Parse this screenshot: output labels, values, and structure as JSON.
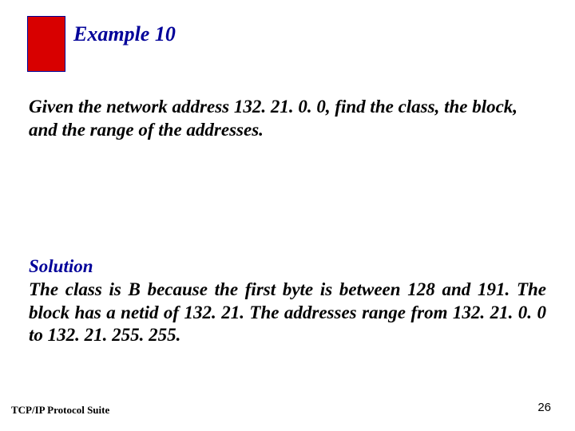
{
  "title": {
    "label": "Example",
    "number": "10"
  },
  "question": "Given the network address 132. 21. 0. 0, find the class, the block, and the range of the addresses.",
  "solution": {
    "label": "Solution",
    "body": "The class is B because the first byte is between 128 and 191. The block has a netid of 132. 21. The addresses range from 132. 21. 0. 0 to 132. 21. 255. 255."
  },
  "footer": {
    "left": "TCP/IP Protocol Suite",
    "page": "26"
  }
}
